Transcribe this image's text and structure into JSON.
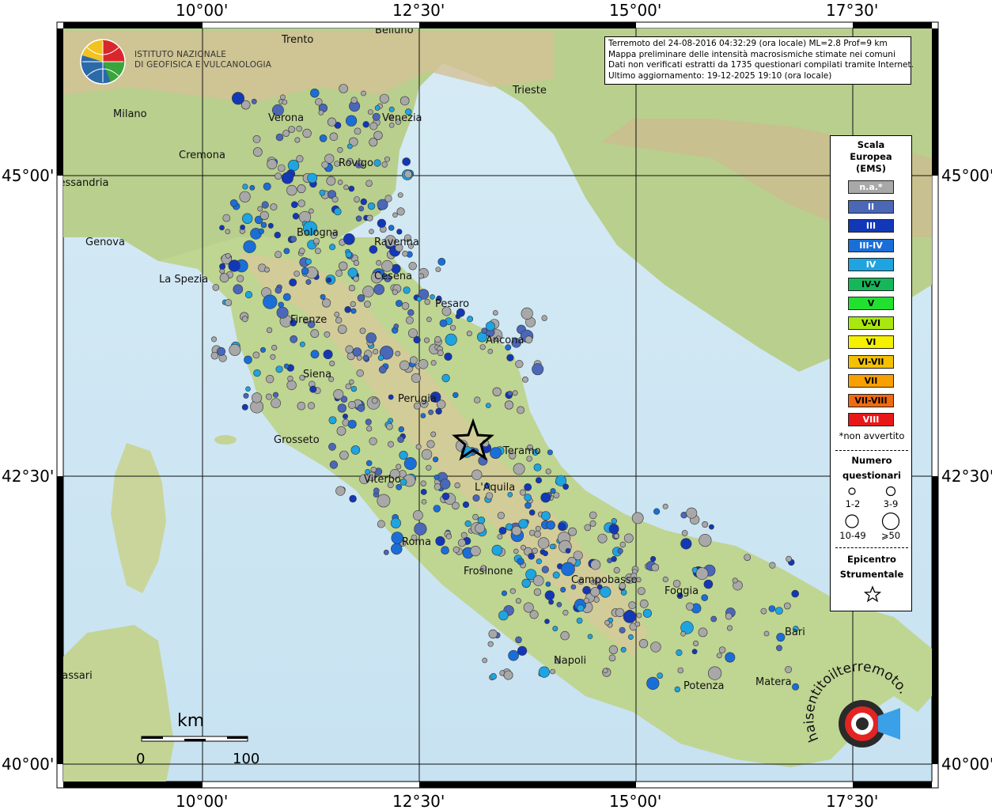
{
  "axes": {
    "top_lon": [
      "10°00'",
      "12°30'",
      "15°00'",
      "17°30'"
    ],
    "bottom_lon": [
      "10°00'",
      "12°30'",
      "15°00'",
      "17°30'"
    ],
    "left_lat": [
      "45°00'",
      "42°30'",
      "40°00'"
    ],
    "right_lat": [
      "45°00'",
      "42°30'",
      "40°00'"
    ]
  },
  "cities": [
    {
      "name": "Trento"
    },
    {
      "name": "Belluno"
    },
    {
      "name": "Milano"
    },
    {
      "name": "Verona"
    },
    {
      "name": "Venezia"
    },
    {
      "name": "Trieste"
    },
    {
      "name": "Cremona"
    },
    {
      "name": "Rovigo"
    },
    {
      "name": "Alessandria"
    },
    {
      "name": "Bologna"
    },
    {
      "name": "Genova"
    },
    {
      "name": "Ravenna"
    },
    {
      "name": "La Spezia"
    },
    {
      "name": "Cesena"
    },
    {
      "name": "Pesaro"
    },
    {
      "name": "Firenze"
    },
    {
      "name": "Ancona"
    },
    {
      "name": "Siena"
    },
    {
      "name": "Perugia"
    },
    {
      "name": "Grosseto"
    },
    {
      "name": "Teramo"
    },
    {
      "name": "Viterbo"
    },
    {
      "name": "L'Aquila"
    },
    {
      "name": "Roma"
    },
    {
      "name": "Frosinone"
    },
    {
      "name": "Campobasso"
    },
    {
      "name": "Foggia"
    },
    {
      "name": "Bari"
    },
    {
      "name": "Napoli"
    },
    {
      "name": "Potenza"
    },
    {
      "name": "Matera"
    },
    {
      "name": "Sassari"
    }
  ],
  "info": {
    "line1": "Terremoto del 24-08-2016 04:32:29 (ora locale) ML=2.8 Prof=9 km",
    "line2": "Mappa preliminare delle intensità macrosismiche stimate nei comuni",
    "line3": "Dati non verificati estratti da 1735 questionari compilati tramite Internet.",
    "line4": "Ultimo aggiornamento: 19-12-2025 19:10 (ora locale)"
  },
  "logo": {
    "line1": "ISTITUTO NAZIONALE",
    "line2": "DI GEOFISICA E VULCANOLOGIA"
  },
  "legend": {
    "title": [
      "Scala",
      "Europea",
      "(EMS)"
    ],
    "classes": [
      {
        "label": "n.a.*",
        "color": "#a8a8a8",
        "text": "#ffffff"
      },
      {
        "label": "II",
        "color": "#4a67b8",
        "text": "#ffffff"
      },
      {
        "label": "III",
        "color": "#1238b8",
        "text": "#ffffff"
      },
      {
        "label": "III-IV",
        "color": "#1a6ed8",
        "text": "#ffffff"
      },
      {
        "label": "IV",
        "color": "#1ea4e0",
        "text": "#ffffff"
      },
      {
        "label": "IV-V",
        "color": "#14b85a",
        "text": "#000000"
      },
      {
        "label": "V",
        "color": "#22e030",
        "text": "#000000"
      },
      {
        "label": "V-VI",
        "color": "#a8e810",
        "text": "#000000"
      },
      {
        "label": "VI",
        "color": "#f4f000",
        "text": "#000000"
      },
      {
        "label": "VI-VII",
        "color": "#f4c000",
        "text": "#000000"
      },
      {
        "label": "VII",
        "color": "#f8a000",
        "text": "#000000"
      },
      {
        "label": "VII-VIII",
        "color": "#f06a10",
        "text": "#000000"
      },
      {
        "label": "VIII",
        "color": "#e81818",
        "text": "#ffffff"
      }
    ],
    "note": "*non avvertito",
    "count_title": [
      "Numero",
      "questionari"
    ],
    "sizes": [
      "1-2",
      "3-9",
      "10-49",
      "⩾50"
    ],
    "epicenter_title": [
      "Epicentro",
      "Strumentale"
    ]
  },
  "scale": {
    "unit": "km",
    "left": "0",
    "right": "100"
  },
  "watermark": {
    "text": "haisentitoilterremoto.it"
  }
}
